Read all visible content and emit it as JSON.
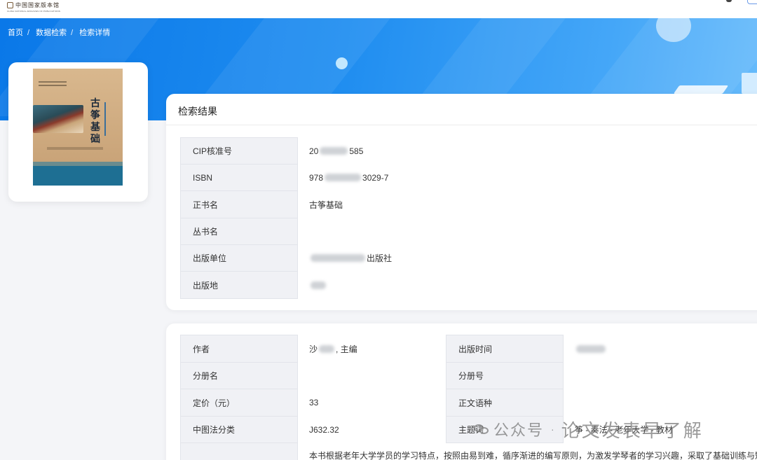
{
  "header": {
    "logo_cn": "中国国家版本馆",
    "logo_en": "CHINA NATIONAL ARCHIVES OF PUBLICATIONS"
  },
  "breadcrumb": [
    "首页",
    "数据检索",
    "检索详情"
  ],
  "cover": {
    "title": "古筝基础"
  },
  "results": {
    "title": "检索结果",
    "rows": [
      {
        "label": "CIP核准号",
        "pre": "20",
        "post": "585"
      },
      {
        "label": "ISBN",
        "pre": "978",
        "post": "3029-7"
      },
      {
        "label": "正书名",
        "pre": "古筝基础",
        "post": ""
      },
      {
        "label": "丛书名",
        "pre": "",
        "post": ""
      },
      {
        "label": "出版单位",
        "pre": "",
        "post": "出版社"
      },
      {
        "label": "出版地",
        "pre": "",
        "post": ""
      }
    ]
  },
  "details": {
    "left": [
      {
        "label": "作者",
        "pre": "沙",
        "post": ", 主编"
      },
      {
        "label": "分册名",
        "pre": "",
        "post": ""
      },
      {
        "label": "定价（元）",
        "pre": "33",
        "post": ""
      },
      {
        "label": "中图法分类",
        "pre": "J632.32",
        "post": ""
      },
      {
        "label": "",
        "pre": "",
        "post": ""
      }
    ],
    "right": [
      {
        "label": "出版时间",
        "value": ""
      },
      {
        "label": "分册号",
        "value": ""
      },
      {
        "label": "正文语种",
        "value": ""
      },
      {
        "label": "主题词",
        "value": "筝 - 奏法 - 老年大学 - 教材"
      }
    ],
    "description": "本书根据老年大学学员的学习特点，按照由易到难，循序渐进的编写原则，为激发学琴者的学习兴趣，采取了基础训练与短"
  },
  "watermark": {
    "brand": "公众号",
    "dot": "·",
    "name": "论文发表早了解"
  },
  "colors": {
    "banner": "#1f8df0",
    "label_bg": "#f0f1f5",
    "page_bg": "#f4f5f8"
  }
}
